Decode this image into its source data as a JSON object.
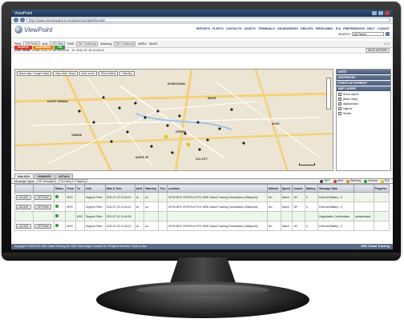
{
  "browser": {
    "title": "ViewPoint",
    "url": "http://www.emsviewpoint.com/pt/en/portal26/tracker"
  },
  "header": {
    "logo_text": "ViewPoint",
    "nav": [
      "REPORTS",
      "FLEETS",
      "CONTACTS",
      "ASSETS",
      "TERMINALS",
      "GEOBORDERS",
      "GROUPS",
      "PERSONNEL",
      "POI",
      "PREFERENCES",
      "HELP",
      "LOGOUT"
    ],
    "search_label": "SEARCH",
    "search_value": "(All Fleets)"
  },
  "status_tabs": [
    "ALERTS",
    "WARNINGS",
    "OK"
  ],
  "filters": {
    "fleet_label": "Fleet",
    "fleet_value": "(All Fleets)",
    "unit_label": "Unit",
    "unit_value": "(All Units)",
    "ems_label": "EMS",
    "ems_value": "(All Conditions)",
    "warning_label": "Warning",
    "warning_value": "(All Conditions)",
    "area_label": "AREA",
    "area_value": "NEAR",
    "page": "1 / 1"
  },
  "live": {
    "label": "LIVE VIEW",
    "from": "From: 2011-07-05 08:25:00",
    "to": "To: 2011-07-19 11:54:13",
    "back_history": "BACK HISTORY"
  },
  "map": {
    "controls": [
      "Base map: Google Maps",
      "Map style: Road",
      "Auto zoom",
      "Show labels",
      "Standby"
    ],
    "labels": [
      "KARTE PARWAN",
      "KHAIR KHANA",
      "TAIMANI",
      "WAZIR",
      "CENTRE",
      "KARTE SE",
      "OLD CITY",
      "BAGH"
    ]
  },
  "side_panel": {
    "units_header": "UNITS",
    "geofences_header": "GEOFENCES",
    "poi_header": "POINTS OF INTEREST",
    "layers_header": "MAP LAYERS",
    "layers": [
      {
        "label": "Show layers",
        "checked": "✓"
      },
      {
        "label": "[Base Map]",
        "checked": "✓"
      },
      {
        "label": "Afghanistan",
        "checked": "✓"
      },
      {
        "label": "Nigeria",
        "checked": ""
      },
      {
        "label": "Sudan",
        "checked": ""
      }
    ]
  },
  "bottom_tabs": [
    "MAILBOX",
    "SUMMARY",
    "DETAILS"
  ],
  "messages": {
    "types_label": "Message Types",
    "types_value": "All messages",
    "direction_value": "Incoming & Outgoing",
    "legend": [
      {
        "label": "RET",
        "color": "#444444"
      },
      {
        "label": "Alert",
        "color": "#d33c2a"
      },
      {
        "label": "Warning",
        "color": "#e88a1a"
      },
      {
        "label": "Normal",
        "color": "#2e9a2e"
      },
      {
        "label": "POI",
        "color": "#e8c21a"
      }
    ],
    "columns": [
      "",
      "",
      "Status",
      "From",
      "To",
      "Unit",
      "Date & Time",
      "Alert",
      "Warning",
      "Text",
      "Location",
      "Altitude",
      "Speed",
      "Course",
      "Battery",
      "Message Data",
      "",
      "Progress"
    ],
    "rows": [
      {
        "a": "LOCATE",
        "b": "OPTIONS",
        "from": "MVS",
        "to": "",
        "unit": "Support Fleet",
        "time": "2011-07-19 11:54:13",
        "alert": "on",
        "warn": "on",
        "text": "",
        "loc": "02*03 18*E 23*20*N el POI: EMS Global Tracking Tombouktou (Villayonni)",
        "alt": "0m",
        "speed": "0km/h",
        "course": "15*",
        "batt": "0",
        "data": "External Battery : 0",
        "extra": "",
        "prog": ""
      },
      {
        "a": "LOCATE",
        "b": "OPTIONS",
        "from": "MVS",
        "to": "",
        "unit": "Support Fleet",
        "time": "2011-07-19 11:44:13",
        "alert": "on",
        "warn": "on",
        "text": "",
        "loc": "02*03 18*E 23*20*N el POI: EMS Global Tracking Tombouktou (Villayonni)",
        "alt": "0m",
        "speed": "0km/h",
        "course": "15*",
        "batt": "0",
        "data": "External Battery : 0",
        "extra": "",
        "prog": ""
      },
      {
        "a": "",
        "b": "",
        "from": "",
        "to": "MVS",
        "unit": "Support Fleet",
        "time": "2011-07-19 11:40:09",
        "alert": "",
        "warn": "",
        "text": "",
        "loc": "",
        "alt": "",
        "speed": "",
        "course": "",
        "batt": "",
        "data": "Registration Confirmation",
        "extra": "administrator",
        "prog": ""
      },
      {
        "a": "LOCATE",
        "b": "OPTIONS",
        "from": "MVS",
        "to": "",
        "unit": "Support Fleet",
        "time": "2011-07-19 11:35:13",
        "alert": "on",
        "warn": "on",
        "text": "",
        "loc": "02*03 18*E 23*20*N el POI: EMS Global Tracking Tombouktou (Villayonni)",
        "alt": "0m",
        "speed": "0km/h",
        "course": "15*",
        "batt": "0",
        "data": "External Battery : 0",
        "extra": "",
        "prog": ""
      }
    ]
  },
  "footer": {
    "copyright": "Copyright © 2009-2011 EMS Global Tracking Ltd. EMS Technologies Canada Ltd. All Rights Reserved. Terms of Use.",
    "brand": "EMS Global Tracking"
  }
}
